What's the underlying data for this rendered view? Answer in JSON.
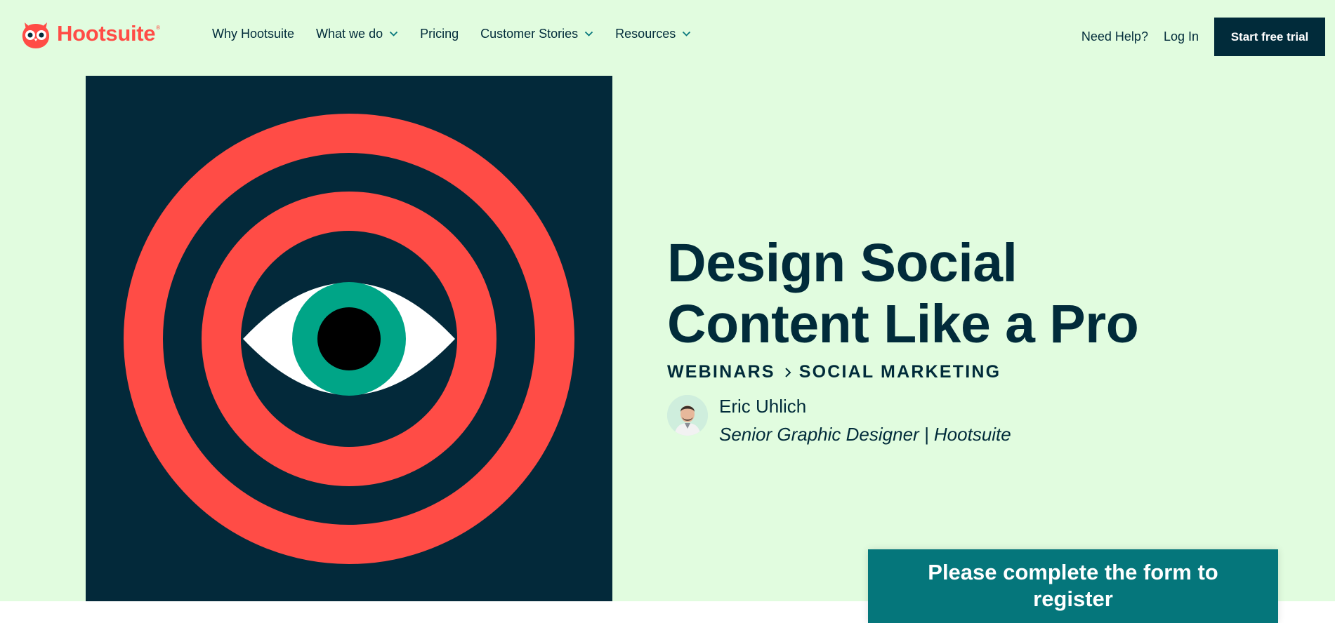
{
  "header": {
    "logo_text": "Hootsuite",
    "logo_reg": "®",
    "nav": [
      {
        "label": "Why Hootsuite",
        "dropdown": false
      },
      {
        "label": "What we do",
        "dropdown": true
      },
      {
        "label": "Pricing",
        "dropdown": false
      },
      {
        "label": "Customer Stories",
        "dropdown": true
      },
      {
        "label": "Resources",
        "dropdown": true
      }
    ],
    "need_help": "Need Help?",
    "login": "Log In",
    "cta": "Start free trial"
  },
  "hero": {
    "title": "Design Social Content Like a Pro",
    "breadcrumb": [
      "WEBINARS",
      "SOCIAL MARKETING"
    ],
    "author_name": "Eric Uhlich",
    "author_role": "Senior Graphic Designer | Hootsuite"
  },
  "form_banner": {
    "title": "Please complete the form to register"
  },
  "colors": {
    "background": "#e1fcdf",
    "navy": "#012b3a",
    "coral": "#ff4c46",
    "teal_banner": "#05767b",
    "eye_teal": "#00a587"
  },
  "icons": {
    "logo": "owl-logo-icon",
    "dropdown": "chevron-down-icon",
    "breadcrumb_separator": "chevron-right-icon"
  }
}
